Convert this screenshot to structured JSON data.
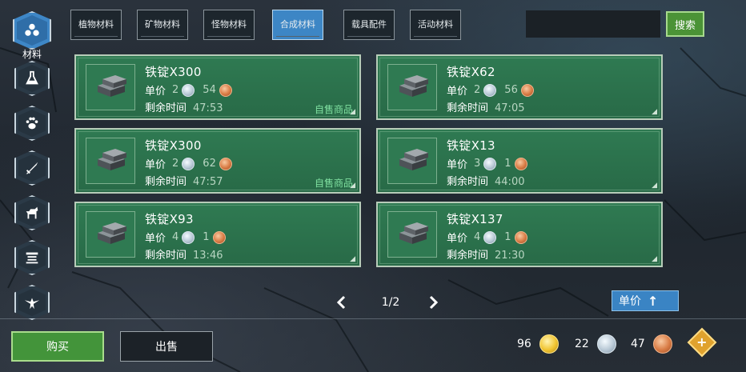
{
  "rail": {
    "items": [
      {
        "icon": "materials-cluster-icon",
        "active": true
      },
      {
        "icon": "flask-icon"
      },
      {
        "icon": "paw-icon"
      },
      {
        "icon": "sword-shield-icon"
      },
      {
        "icon": "horse-icon"
      },
      {
        "icon": "scroll-icon"
      },
      {
        "icon": "bird-icon"
      }
    ],
    "active_label": "材料"
  },
  "tabs": [
    {
      "label": "植物材料",
      "active": false
    },
    {
      "label": "矿物材料",
      "active": false
    },
    {
      "label": "怪物材料",
      "active": false
    },
    {
      "label": "合成材料",
      "active": true
    },
    {
      "label": "载具配件",
      "active": false
    },
    {
      "label": "活动材料",
      "active": false
    }
  ],
  "search": {
    "button_label": "搜索"
  },
  "labels": {
    "price": "单价",
    "time_left": "剩余时间",
    "self_sale": "自售商品"
  },
  "listings": [
    {
      "name": "铁锭X300",
      "silver": "2",
      "copper": "54",
      "time": "47:53",
      "self_sale": true
    },
    {
      "name": "铁锭X62",
      "silver": "2",
      "copper": "56",
      "time": "47:05",
      "self_sale": false
    },
    {
      "name": "铁锭X300",
      "silver": "2",
      "copper": "62",
      "time": "47:57",
      "self_sale": true
    },
    {
      "name": "铁锭X13",
      "silver": "3",
      "copper": "1",
      "time": "44:00",
      "self_sale": false
    },
    {
      "name": "铁锭X93",
      "silver": "4",
      "copper": "1",
      "time": "13:46",
      "self_sale": false
    },
    {
      "name": "铁锭X137",
      "silver": "4",
      "copper": "1",
      "time": "21:30",
      "self_sale": false
    }
  ],
  "pager": {
    "text": "1/2"
  },
  "sort": {
    "label": "单价",
    "direction": "ascending"
  },
  "buttons": {
    "buy": "购买",
    "sell": "出售"
  },
  "wallet": {
    "gold": "96",
    "silver": "22",
    "copper": "47"
  },
  "colors": {
    "accent_blue": "#3d86c5",
    "card_green": "#2f7a52",
    "action_green": "#43943a",
    "self_sale_text": "#7fe0a0"
  }
}
